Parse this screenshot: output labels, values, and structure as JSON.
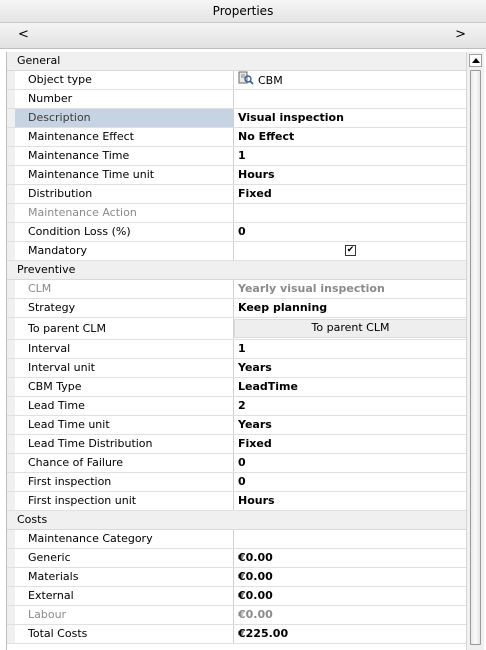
{
  "window": {
    "title": "Properties"
  },
  "nav": {
    "left": "<",
    "right": ">"
  },
  "icons": {
    "object_type": "cbm-object-icon",
    "mandatory_check": "✔"
  },
  "sections": {
    "general": {
      "title": "General",
      "rows": [
        {
          "label": "Object type",
          "value": "CBM"
        },
        {
          "label": "Number",
          "value": ""
        },
        {
          "label": "Description",
          "value": "Visual inspection"
        },
        {
          "label": "Maintenance Effect",
          "value": "No Effect"
        },
        {
          "label": "Maintenance Time",
          "value": "1"
        },
        {
          "label": "Maintenance Time unit",
          "value": "Hours"
        },
        {
          "label": "Distribution",
          "value": "Fixed"
        },
        {
          "label": "Maintenance Action",
          "value": ""
        },
        {
          "label": "Condition Loss (%)",
          "value": "0"
        },
        {
          "label": "Mandatory",
          "value": true
        }
      ]
    },
    "preventive": {
      "title": "Preventive",
      "rows": [
        {
          "label": "CLM",
          "value": "Yearly visual inspection"
        },
        {
          "label": "Strategy",
          "value": "Keep planning"
        },
        {
          "label": "To parent CLM",
          "value": "To parent CLM"
        },
        {
          "label": "Interval",
          "value": "1"
        },
        {
          "label": "Interval unit",
          "value": "Years"
        },
        {
          "label": "CBM Type",
          "value": "LeadTime"
        },
        {
          "label": "Lead Time",
          "value": "2"
        },
        {
          "label": "Lead Time unit",
          "value": "Years"
        },
        {
          "label": "Lead Time Distribution",
          "value": "Fixed"
        },
        {
          "label": "Chance of Failure",
          "value": "0"
        },
        {
          "label": "First inspection",
          "value": "0"
        },
        {
          "label": "First inspection unit",
          "value": "Hours"
        }
      ]
    },
    "costs": {
      "title": "Costs",
      "rows": [
        {
          "label": "Maintenance Category",
          "value": ""
        },
        {
          "label": "Generic",
          "value": "€0.00"
        },
        {
          "label": "Materials",
          "value": "€0.00"
        },
        {
          "label": "External",
          "value": "€0.00"
        },
        {
          "label": "Labour",
          "value": "€0.00"
        },
        {
          "label": "Total Costs",
          "value": "€225.00"
        }
      ]
    }
  }
}
